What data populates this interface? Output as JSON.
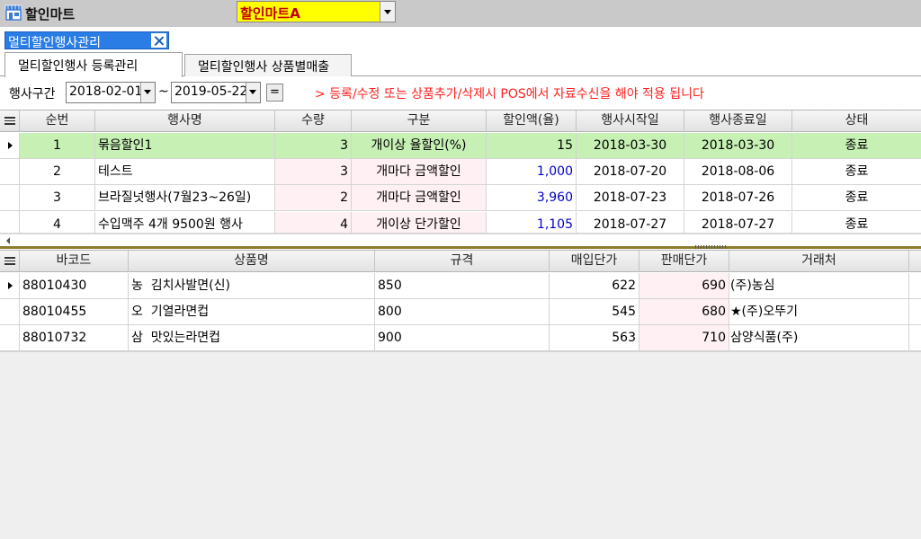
{
  "app": {
    "title": "할인마트",
    "store_select": "할인마트A"
  },
  "doc_tab": {
    "label": "멀티할인행사관리"
  },
  "page_tabs": [
    "멀티할인행사 등록관리",
    "멀티할인행사 상품별매출"
  ],
  "filter": {
    "period_label": "행사구간",
    "date_from": "2018-02-01",
    "tilde": "~",
    "date_to": "2019-05-22",
    "eq_button": "=",
    "notice": "> 등록/수정 또는 상품추가/삭제시 POS에서 자료수신을 해야 적용 됩니다"
  },
  "event_grid": {
    "columns": [
      "순번",
      "행사명",
      "수량",
      "구분",
      "할인액(율)",
      "행사시작일",
      "행사종료일",
      "상태"
    ],
    "rows": [
      {
        "no": "1",
        "name": "묶음할인1",
        "qty": "3",
        "type": "개이상 율할인(%)",
        "discount": "15",
        "start": "2018-03-30",
        "end": "2018-03-30",
        "status": "종료"
      },
      {
        "no": "2",
        "name": "테스트",
        "qty": "3",
        "type": "개마다 금액할인",
        "discount": "1,000",
        "start": "2018-07-20",
        "end": "2018-08-06",
        "status": "종료"
      },
      {
        "no": "3",
        "name": "브라질넛행사(7월23~26일)",
        "qty": "2",
        "type": "개마다 금액할인",
        "discount": "3,960",
        "start": "2018-07-23",
        "end": "2018-07-26",
        "status": "종료"
      },
      {
        "no": "4",
        "name": "수입맥주 4개 9500원 행사",
        "qty": "4",
        "type": "개이상 단가할인",
        "discount": "1,105",
        "start": "2018-07-27",
        "end": "2018-07-27",
        "status": "종료"
      }
    ]
  },
  "product_grid": {
    "columns": [
      "바코드",
      "상품명",
      "규격",
      "매입단가",
      "판매단가",
      "거래처"
    ],
    "rows": [
      {
        "barcode": "88010430",
        "name": "농  김치사발면(신)",
        "spec": "850",
        "cost": "622",
        "price": "690",
        "vendor": "(주)농심"
      },
      {
        "barcode": "88010455",
        "name": "오  기열라면컵",
        "spec": "800",
        "cost": "545",
        "price": "680",
        "vendor": "★(주)오뚜기"
      },
      {
        "barcode": "88010732",
        "name": "삼  맛있는라면컵",
        "spec": "900",
        "cost": "563",
        "price": "710",
        "vendor": "삼양식품(주)"
      }
    ]
  }
}
